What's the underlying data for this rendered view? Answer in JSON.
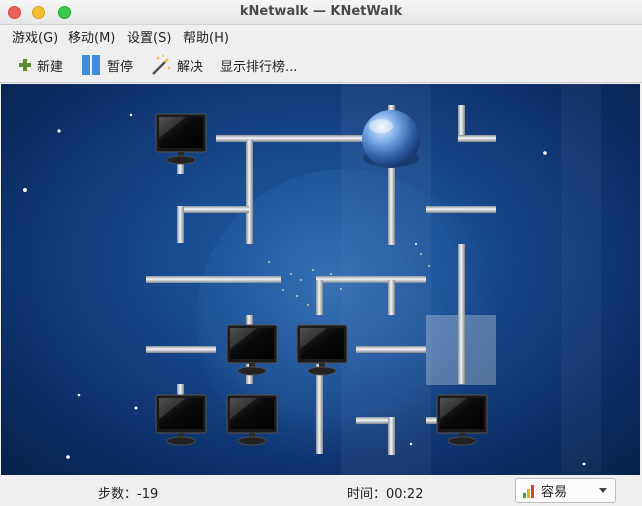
{
  "window": {
    "title": "kNetwalk — KNetWalk"
  },
  "menu": {
    "items": [
      {
        "label": "游戏(G)"
      },
      {
        "label": "移动(M)"
      },
      {
        "label": "设置(S)"
      },
      {
        "label": "帮助(H)"
      }
    ]
  },
  "toolbar": {
    "new_label": "新建",
    "pause_label": "暂停",
    "solve_label": "解决",
    "highscores_label": "显示排行榜..."
  },
  "status": {
    "moves": "步数：-19",
    "time": "时间：00:22",
    "difficulty": "容易"
  },
  "colors": {
    "board_bg": "#174a8e",
    "cable": "#c8ccd2",
    "highlight": "#a9b8cc"
  },
  "icons": {
    "new": "plus-icon",
    "pause": "pause-icon",
    "solve": "magic-wand-icon",
    "difficulty": "bars-icon",
    "server": "globe-icon",
    "terminal": "monitor-icon"
  }
}
